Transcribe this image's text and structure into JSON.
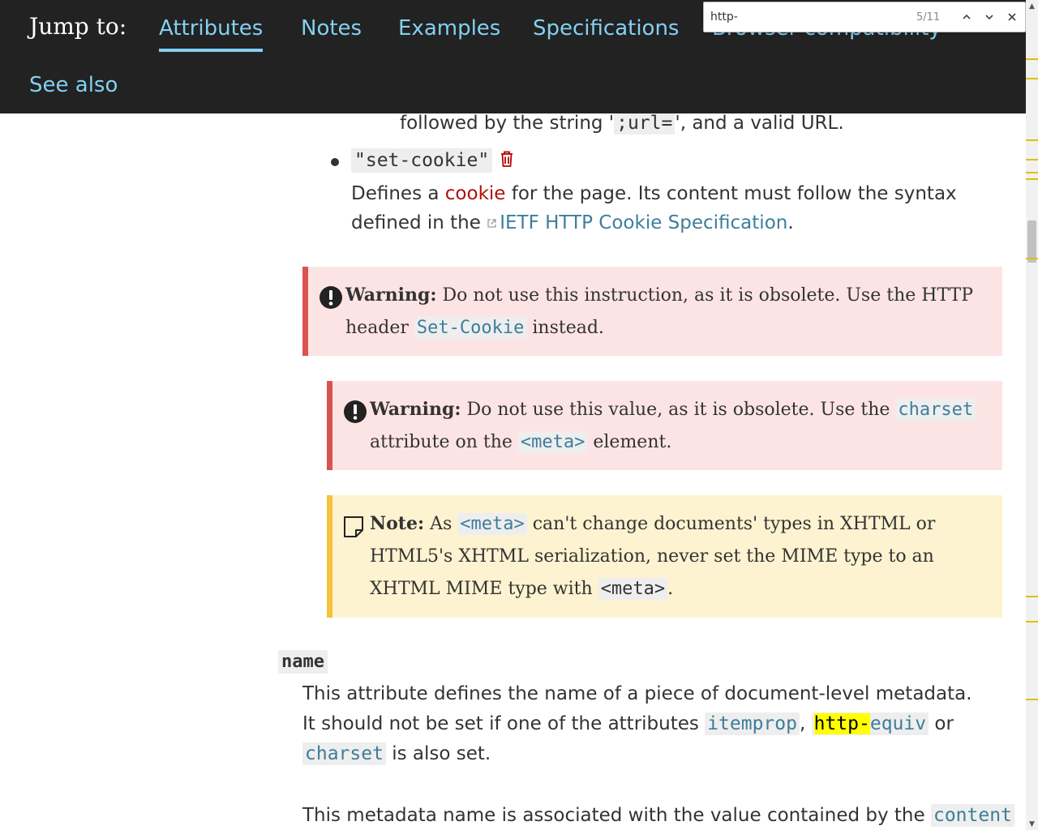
{
  "jumpbar": {
    "label": "Jump to:",
    "links": [
      "Attributes",
      "Notes",
      "Examples",
      "Specifications",
      "Browser compatibility",
      "See also"
    ]
  },
  "findbar": {
    "query": "http-",
    "count": "5/11",
    "prev_icon": "chevron-up-icon",
    "next_icon": "chevron-down-icon",
    "close_icon": "close-icon"
  },
  "content": {
    "refresh_tail": {
      "pre": "followed by the string '",
      "code": ";url=",
      "post": "', and a valid URL."
    },
    "set_cookie": {
      "code": "\"set-cookie\"",
      "icon": "trash-icon",
      "desc_pre": "Defines a ",
      "cookie_link": "cookie",
      "desc_mid": " for the page. Its content must follow the syntax defined in the ",
      "ietf_link": "IETF HTTP Cookie Specification",
      "desc_post": "."
    },
    "warning1": {
      "icon": "warning-icon",
      "label": "Warning:",
      "text_pre": " Do not use this instruction, as it is obsolete. Use the HTTP header ",
      "code": "Set-Cookie",
      "text_post": " instead."
    },
    "warning2": {
      "icon": "warning-icon",
      "label": "Warning:",
      "text_pre": " Do not use this value, as it is obsolete. Use the ",
      "code1": "charset",
      "text_mid": " attribute on the ",
      "code2": "<meta>",
      "text_post": " element."
    },
    "note": {
      "icon": "note-icon",
      "label": "Note:",
      "text_pre": " As ",
      "code1": "<meta>",
      "text_mid": " can't change documents' types in XHTML or HTML5's XHTML serialization, never set the MIME type to an XHTML MIME type with ",
      "code2": "<meta>",
      "text_post": "."
    },
    "name_attr": {
      "term": "name",
      "p1_pre": "This attribute defines the name of a piece of document-level metadata. It should not be set if one of the attributes ",
      "code_itemprop": "itemprop",
      "sep1": ", ",
      "code_http_hl": "http-",
      "code_http_rest": "equiv",
      "sep2": " or ",
      "code_charset": "charset",
      "p1_post": " is also set.",
      "p2_pre": "This metadata name is associated with the value contained by the ",
      "code_content": "content"
    }
  },
  "colors": {
    "header_bg": "#222222",
    "link": "#83d0f2",
    "doc_link": "#3d7e9a",
    "warning_bg": "#fde4e4",
    "warning_border": "#d9534f",
    "note_bg": "#fdf3d0",
    "note_border": "#f4c33a",
    "highlight": "#ffff00"
  }
}
